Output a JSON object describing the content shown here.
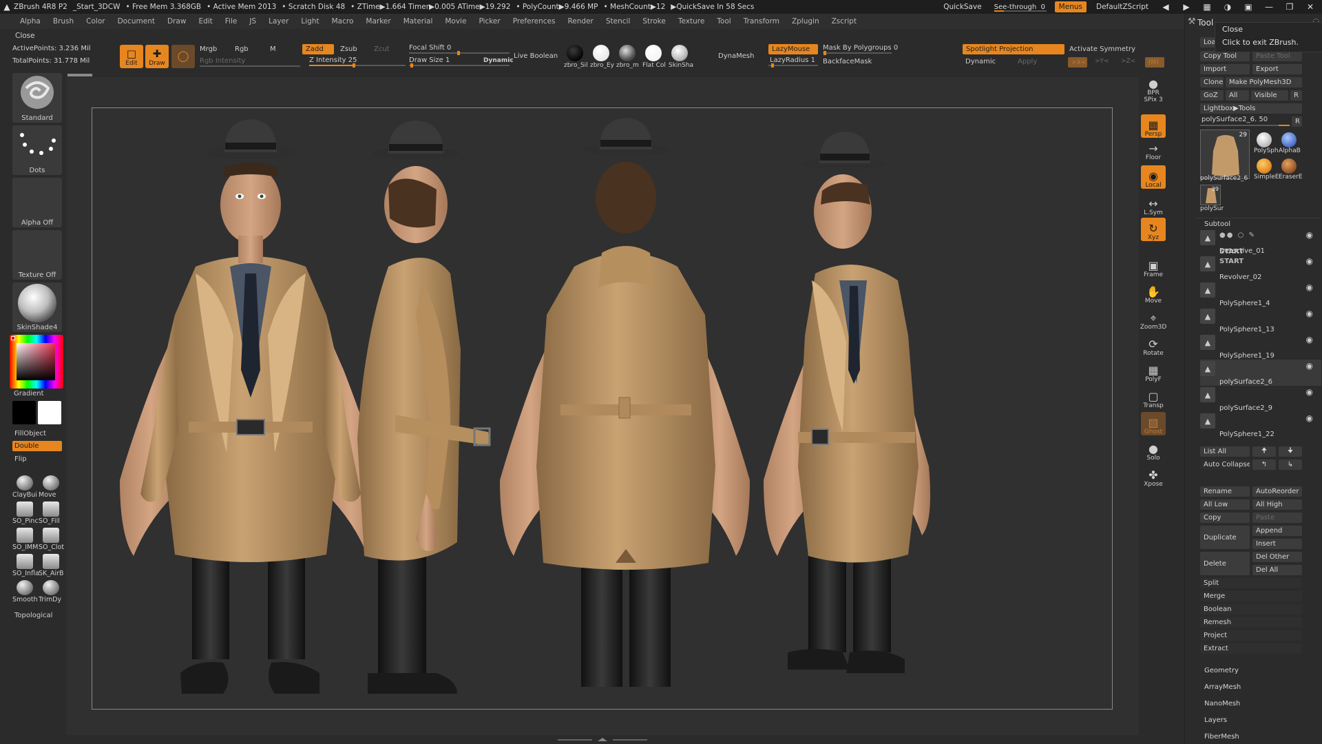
{
  "title_bar": {
    "app": "ZBrush 4R8 P2",
    "document": "_Start_3DCW",
    "free_mem": "• Free Mem 3.368GB",
    "active_mem": "• Active Mem 2013",
    "scratch_disk": "• Scratch Disk 48",
    "ztime": "• ZTime▶1.664 Timer▶0.005 ATime▶19.292",
    "polycount": "• PolyCount▶9.466 MP",
    "meshcount": "• MeshCount▶12",
    "quicksave_in": "▶QuickSave In 58 Secs",
    "quicksave": "QuickSave",
    "see_through": "See-through",
    "see_through_value": "0",
    "menus": "Menus",
    "default_zscript": "DefaultZScript"
  },
  "menu_bar": [
    "Alpha",
    "Brush",
    "Color",
    "Document",
    "Draw",
    "Edit",
    "File",
    "JS",
    "Layer",
    "Light",
    "Macro",
    "Marker",
    "Material",
    "Movie",
    "Picker",
    "Preferences",
    "Render",
    "Stencil",
    "Stroke",
    "Texture",
    "Tool",
    "Transform",
    "Zplugin",
    "Zscript"
  ],
  "close_label": "Close",
  "stats": {
    "active_points": "ActivePoints: 3.236 Mil",
    "total_points": "TotalPoints: 31.778 Mil"
  },
  "shelf": {
    "edit": "Edit",
    "draw": "Draw",
    "mrgb": "Mrgb",
    "rgb": "Rgb",
    "m": "M",
    "rgb_intensity": "Rgb Intensity",
    "zadd": "Zadd",
    "zsub": "Zsub",
    "zcut": "Zcut",
    "z_intensity": "Z Intensity 25",
    "focal_shift": "Focal Shift 0",
    "draw_size": "Draw Size 1",
    "dynamic": "Dynamic",
    "live_boolean": "Live Boolean",
    "materials": [
      "zbro_Sil",
      "zbro_Ey",
      "zbro_m",
      "Flat Col",
      "SkinSha"
    ],
    "dynamesh": "DynaMesh",
    "lazymouse": "LazyMouse",
    "lazyradius": "LazyRadius 1",
    "mask_by_polygroups": "Mask By Polygroups 0",
    "backface_mask": "BackfaceMask",
    "spotlight_projection": "Spotlight Projection",
    "activate_symmetry": "Activate Symmetry",
    "dynamic2": "Dynamic",
    "apply": "Apply",
    "sym_x": ">X<",
    "sym_y": ">Y<",
    "sym_z": ">Z<",
    "sym_m": "(M)"
  },
  "left_tray": {
    "brush": "Standard",
    "stroke": "Dots",
    "alpha": "Alpha Off",
    "texture": "Texture Off",
    "material": "SkinShade4",
    "gradient": "Gradient",
    "fill_object": "FillObject",
    "double": "Double",
    "flip": "Flip",
    "brushes": [
      "ClayBui",
      "Move",
      "SO_Pinc",
      "SO_Fill",
      "SO_IMM",
      "SO_Clot",
      "SO_Infla",
      "SK_AirB",
      "Smooth",
      "TrimDy"
    ],
    "topological": "Topological"
  },
  "right_shelf": [
    "BPR",
    "SPix 3",
    "Persp",
    "Floor",
    "Local",
    "L.Sym",
    "Xyz",
    "Frame",
    "Move",
    "Zoom3D",
    "Rotate",
    "PolyF",
    "Transp",
    "Ghost",
    "Solo",
    "Xpose"
  ],
  "tool_palette": {
    "title": "Tool",
    "load": "Load",
    "tooltip_title": "Close",
    "tooltip_text": "Click to exit ZBrush.",
    "copy_tool": "Copy Tool",
    "paste_tool": "Paste Tool",
    "import": "Import",
    "export": "Export",
    "clone": "Clone",
    "make_polymesh": "Make PolyMesh3D",
    "goz": "GoZ",
    "all": "All",
    "visible": "Visible",
    "r": "R",
    "lightbox_tools": "Lightbox▶Tools",
    "current_tool": "polySurface2_6. 50",
    "thumb_count": "29",
    "thumb_name": "polySurface2_6",
    "tool_thumbs": [
      "PolySph",
      "AlphaB",
      "SimpleE",
      "EraserE"
    ],
    "small_thumb": "polySur",
    "small_thumb_count": "29",
    "subtool_header": "Subtool",
    "subtools": [
      "Detective_01",
      "Revolver_02",
      "PolySphere1_4",
      "PolySphere1_13",
      "PolySphere1_19",
      "polySurface2_6",
      "polySurface2_9",
      "PolySphere1_22"
    ],
    "start_label": "START",
    "list_all": "List All",
    "auto_collapse": "Auto Collapse",
    "rename": "Rename",
    "auto_reorder": "AutoReorder",
    "all_low": "All Low",
    "all_high": "All High",
    "copy": "Copy",
    "paste": "Paste",
    "duplicate": "Duplicate",
    "append": "Append",
    "insert": "Insert",
    "delete": "Delete",
    "del_other": "Del Other",
    "del_all": "Del All",
    "split": "Split",
    "merge": "Merge",
    "boolean": "Boolean",
    "remesh": "Remesh",
    "project": "Project",
    "extract": "Extract",
    "sub_palettes": [
      "Geometry",
      "ArrayMesh",
      "NanoMesh",
      "Layers",
      "FiberMesh"
    ]
  },
  "colors": {
    "accent": "#e7861f",
    "panel": "#2b2b2b",
    "button": "#3c3c3c",
    "coat": "#c29a6a",
    "canvas": "#303030"
  }
}
